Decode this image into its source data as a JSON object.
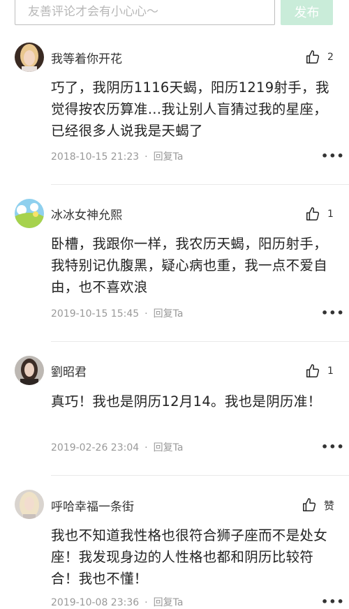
{
  "search": {
    "placeholder": "友善评论才会有小心心～"
  },
  "publish_label": "发布",
  "comments": [
    {
      "username": "我等着你开花",
      "like_count": "2",
      "text": "巧了，我阴历1116天蝎，阳历1219射手，我觉得按农历算准…我让别人盲猜过我的星座，已经很多人说我是天蝎了",
      "time": "2018-10-15 21:23",
      "reply_label": "回复Ta",
      "more_label": "•••"
    },
    {
      "username": "冰冰女神允熙",
      "like_count": "1",
      "text": "卧槽，我跟你一样，我农历天蝎，阳历射手，我特别记仇腹黑，疑心病也重，我一点不爱自由，也不喜欢浪",
      "time": "2019-10-15 15:45",
      "reply_label": "回复Ta",
      "more_label": "•••"
    },
    {
      "username": "劉昭君",
      "like_count": "1",
      "text": "真巧！我也是阴历12月14。我也是阴历准！",
      "time": "2019-02-26 23:04",
      "reply_label": "回复Ta",
      "more_label": "•••"
    },
    {
      "username": "呼哈幸福一条街",
      "like_count": "赞",
      "text": "我也不知道我性格也很符合狮子座而不是处女座！我发现身边的人性格也都和阴历比较符合！我也不懂！",
      "time": "2019-10-08 23:36",
      "reply_label": "回复Ta",
      "more_label": "•••"
    }
  ],
  "colors": {
    "publish_bg": "#c9ecd9",
    "meta_text": "#999999",
    "divider": "#e9e9e9"
  }
}
